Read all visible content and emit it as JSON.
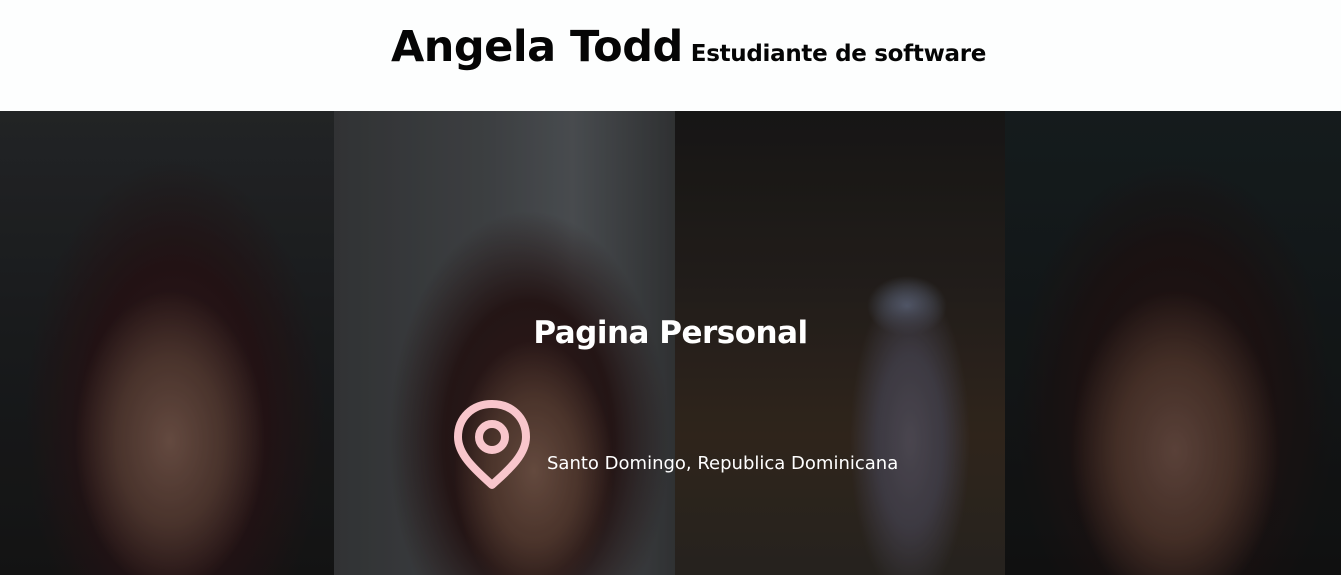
{
  "header": {
    "name": "Angela Todd",
    "role": "Estudiante de software"
  },
  "hero": {
    "heading": "Pagina Personal",
    "location_icon": "map-pin-icon",
    "location_text": "Santo Domingo, Republica Dominicana"
  },
  "colors": {
    "pin_color": "#f8c6cc",
    "text_light": "#ffffff",
    "text_dark": "#050505"
  }
}
